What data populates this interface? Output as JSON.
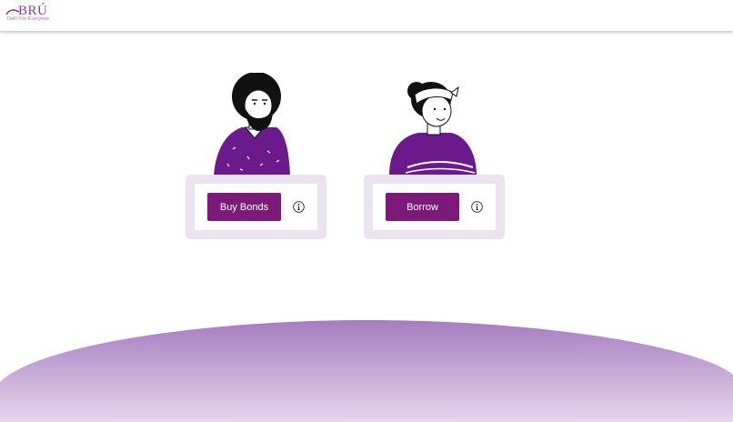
{
  "header": {
    "logo_text": "BRÚ",
    "logo_tagline": "DeFi For Everyone"
  },
  "actions": {
    "buy_bonds": {
      "label": "Buy Bonds",
      "icon": "info-icon"
    },
    "borrow": {
      "label": "Borrow",
      "icon": "info-icon"
    }
  },
  "colors": {
    "brand": "#7b1a78",
    "card_bg": "#ece3f0",
    "wave_top": "#a57dbf",
    "wave_bottom": "#e6d6ee"
  }
}
